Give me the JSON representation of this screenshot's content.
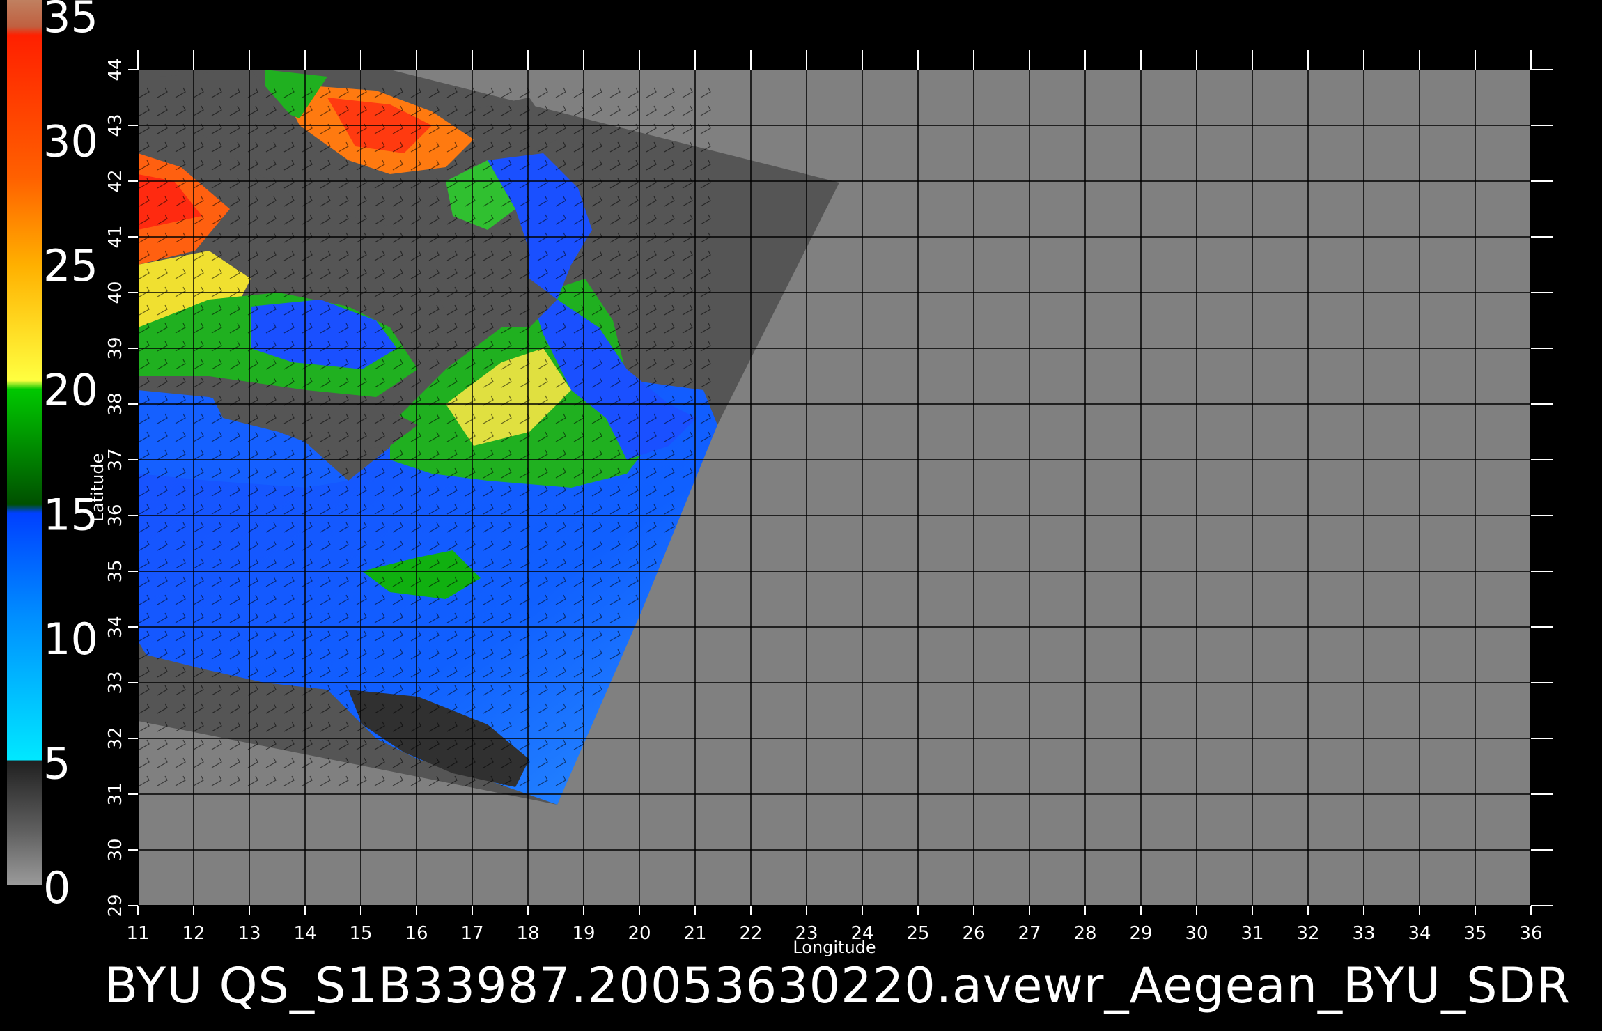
{
  "colorbar": {
    "ticks": [
      "35",
      "30",
      "25",
      "20",
      "15",
      "10",
      "5",
      "0"
    ],
    "colors": [
      "#9a9a9a",
      "#606060",
      "#222222",
      "#00e8ff",
      "#0090ff",
      "#0040ff",
      "#005a00",
      "#00c800",
      "#ffff40",
      "#ffb000",
      "#ff6000",
      "#ff2000",
      "#c06040"
    ]
  },
  "axes": {
    "xlabel": "Longitude",
    "ylabel": "Latitude",
    "x_ticks": [
      "11",
      "12",
      "13",
      "14",
      "15",
      "16",
      "17",
      "18",
      "19",
      "20",
      "21",
      "22",
      "23",
      "24",
      "25",
      "26",
      "27",
      "28",
      "29",
      "30",
      "31",
      "32",
      "33",
      "34",
      "35",
      "36"
    ],
    "y_ticks": [
      "29",
      "30",
      "31",
      "32",
      "33",
      "34",
      "35",
      "36",
      "37",
      "38",
      "39",
      "40",
      "41",
      "42",
      "43",
      "44"
    ],
    "x_range": [
      11,
      36
    ],
    "y_range": [
      29,
      44
    ],
    "grid": true
  },
  "title": "BYU  QS_S1B33987.20053630220.avewr_Aegean_BYU_SDR",
  "colors": {
    "background": "#000000",
    "no_data": "#808080",
    "swath_land": "#555555",
    "grid": "#000000",
    "text": "#ffffff"
  }
}
